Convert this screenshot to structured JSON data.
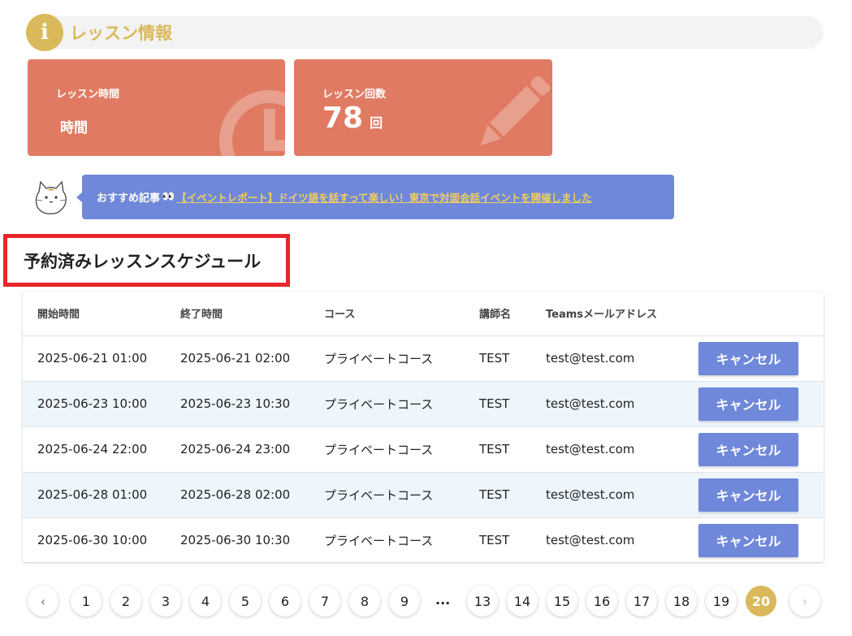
{
  "section": {
    "icon": "info-icon",
    "icon_glyph": "i",
    "title": "レッスン情報"
  },
  "stats": {
    "time": {
      "label": "レッスン時間",
      "value": "時間",
      "icon": "clock-icon"
    },
    "count": {
      "label": "レッスン回数",
      "value": "78",
      "unit": "回",
      "icon": "pencil-icon"
    }
  },
  "recommendation": {
    "avatar": "cat-avatar-icon",
    "label": "おすすめ記事",
    "eyes": "👀",
    "link_text": "【イベントレポート】ドイツ語を話すって楽しい！東京で対面会話イベントを開催しました"
  },
  "schedule": {
    "title": "予約済みレッスンスケジュール",
    "columns": [
      "開始時間",
      "終了時間",
      "コース",
      "講師名",
      "Teamsメールアドレス",
      ""
    ],
    "rows": [
      {
        "start": "2025-06-21 01:00",
        "end": "2025-06-21 02:00",
        "course": "プライベートコース",
        "teacher": "TEST",
        "email": "test@test.com",
        "action": "キャンセル"
      },
      {
        "start": "2025-06-23 10:00",
        "end": "2025-06-23 10:30",
        "course": "プライベートコース",
        "teacher": "TEST",
        "email": "test@test.com",
        "action": "キャンセル"
      },
      {
        "start": "2025-06-24 22:00",
        "end": "2025-06-24 23:00",
        "course": "プライベートコース",
        "teacher": "TEST",
        "email": "test@test.com",
        "action": "キャンセル"
      },
      {
        "start": "2025-06-28 01:00",
        "end": "2025-06-28 02:00",
        "course": "プライベートコース",
        "teacher": "TEST",
        "email": "test@test.com",
        "action": "キャンセル"
      },
      {
        "start": "2025-06-30 10:00",
        "end": "2025-06-30 10:30",
        "course": "プライベートコース",
        "teacher": "TEST",
        "email": "test@test.com",
        "action": "キャンセル"
      }
    ]
  },
  "pagination": {
    "prev_icon": "chevron-left-icon",
    "next_icon": "chevron-right-icon",
    "prev_glyph": "‹",
    "next_glyph": "›",
    "pages": [
      "1",
      "2",
      "3",
      "4",
      "5",
      "6",
      "7",
      "8",
      "9",
      "13",
      "14",
      "15",
      "16",
      "17",
      "18",
      "19",
      "20"
    ],
    "ellipsis": "...",
    "current": "20"
  },
  "colors": {
    "accent_gold": "#d9b95a",
    "card_coral": "#e07a62",
    "primary_blue": "#6f88d9",
    "title_border_red": "#e8262b",
    "row_alt": "#eef6fd"
  }
}
